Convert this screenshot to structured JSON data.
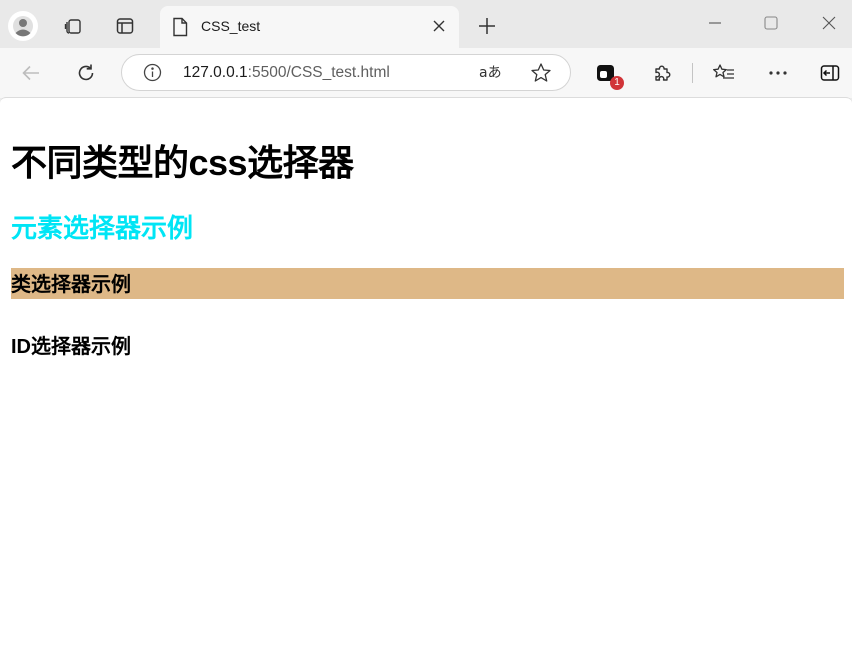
{
  "tab": {
    "title": "CSS_test"
  },
  "address_bar": {
    "host": "127.0.0.1",
    "rest": ":5500/CSS_test.html"
  },
  "extensions": {
    "badge_count": "1"
  },
  "page": {
    "h1": "不同类型的css选择器",
    "element_selector_heading": "元素选择器示例",
    "class_selector_heading": "类选择器示例",
    "id_selector_heading": "ID选择器示例"
  },
  "colors": {
    "element_selector": "#00e5f5",
    "class_selector_bg": "#deb887"
  },
  "icons": {
    "profile": "profile-icon",
    "workspaces": "workspaces-icon",
    "tab_actions": "tab-actions-icon",
    "page": "page-icon",
    "close": "close-icon",
    "new_tab": "plus-icon",
    "minimize": "minimize-icon",
    "maximize": "maximize-icon",
    "window_close": "window-close-icon",
    "back": "back-arrow-icon",
    "refresh": "refresh-icon",
    "info": "info-icon",
    "read_aloud": "read-aloud-icon",
    "favorite": "star-icon",
    "extension_app": "extension-app-icon",
    "extensions": "puzzle-icon",
    "favorites": "favorites-list-icon",
    "more": "more-icon",
    "sidebar": "sidebar-icon"
  }
}
